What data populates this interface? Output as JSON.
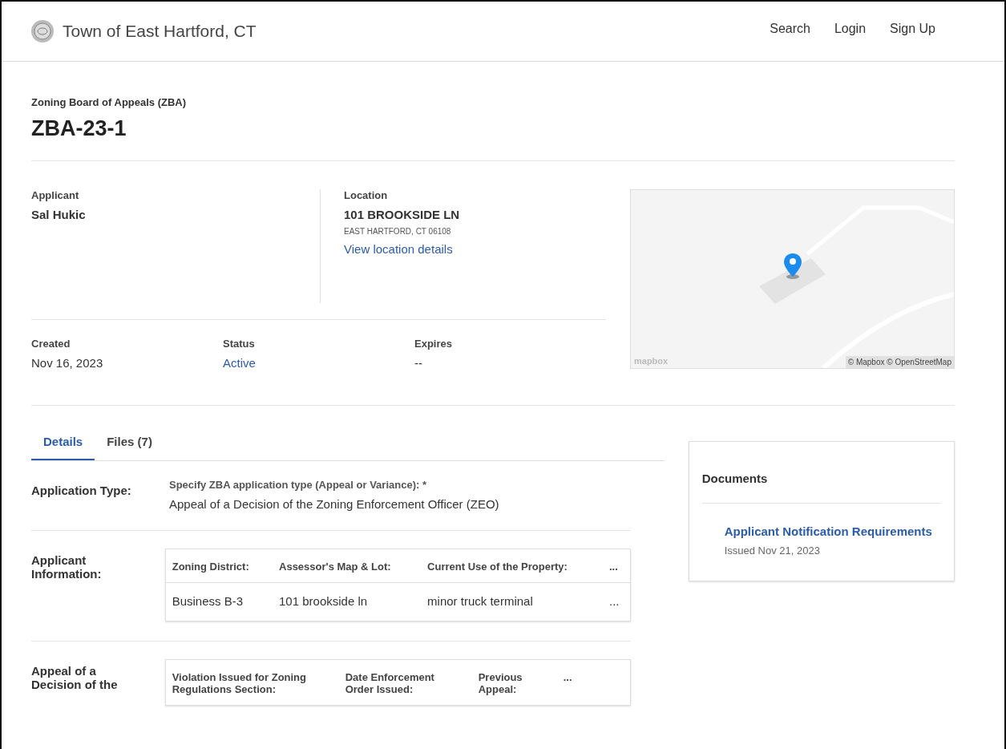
{
  "header": {
    "site_title": "Town of East Hartford, CT",
    "nav": [
      "Search",
      "Login",
      "Sign Up"
    ]
  },
  "record": {
    "category": "Zoning Board of Appeals (ZBA)",
    "number": "ZBA-23-1"
  },
  "applicant": {
    "label": "Applicant",
    "name": "Sal Hukic"
  },
  "location": {
    "label": "Location",
    "address": "101 BROOKSIDE LN",
    "city": "EAST HARTFORD, CT 06108",
    "link": "View location details"
  },
  "facts": [
    {
      "label": "Created",
      "value": "Nov 16, 2023",
      "kind": "text"
    },
    {
      "label": "Status",
      "value": "Active",
      "kind": "link"
    },
    {
      "label": "Expires",
      "value": "--",
      "kind": "text"
    }
  ],
  "map": {
    "logo": "mapbox",
    "attribution": "© Mapbox © OpenStreetMap"
  },
  "tabs": [
    {
      "label": "Details",
      "selected": true
    },
    {
      "label": "Files (7)",
      "selected": false
    }
  ],
  "sections": [
    {
      "label": "Application Type:",
      "kind": "field",
      "field_label": "Specify ZBA application type (Appeal or Variance): *",
      "field_value": "Appeal of a Decision of the Zoning Enforcement Officer (ZEO)"
    },
    {
      "label": "Applicant Information:",
      "kind": "table",
      "columns": [
        "Zoning District:",
        "Assessor's Map & Lot:",
        "Current Use of the Property:",
        "..."
      ],
      "rows": [
        [
          "Business B-3",
          "101 brookside ln",
          "minor truck terminal",
          "..."
        ]
      ]
    },
    {
      "label": "Appeal of a Decision of the",
      "kind": "table",
      "columns": [
        "Violation Issued for Zoning Regulations Section:",
        "Date Enforcement Order Issued:",
        "Previous Appeal:",
        "..."
      ]
    }
  ],
  "documents": {
    "title": "Documents",
    "items": [
      {
        "name": "Applicant Notification Requirements",
        "issued": "Issued Nov 21, 2023"
      }
    ]
  }
}
